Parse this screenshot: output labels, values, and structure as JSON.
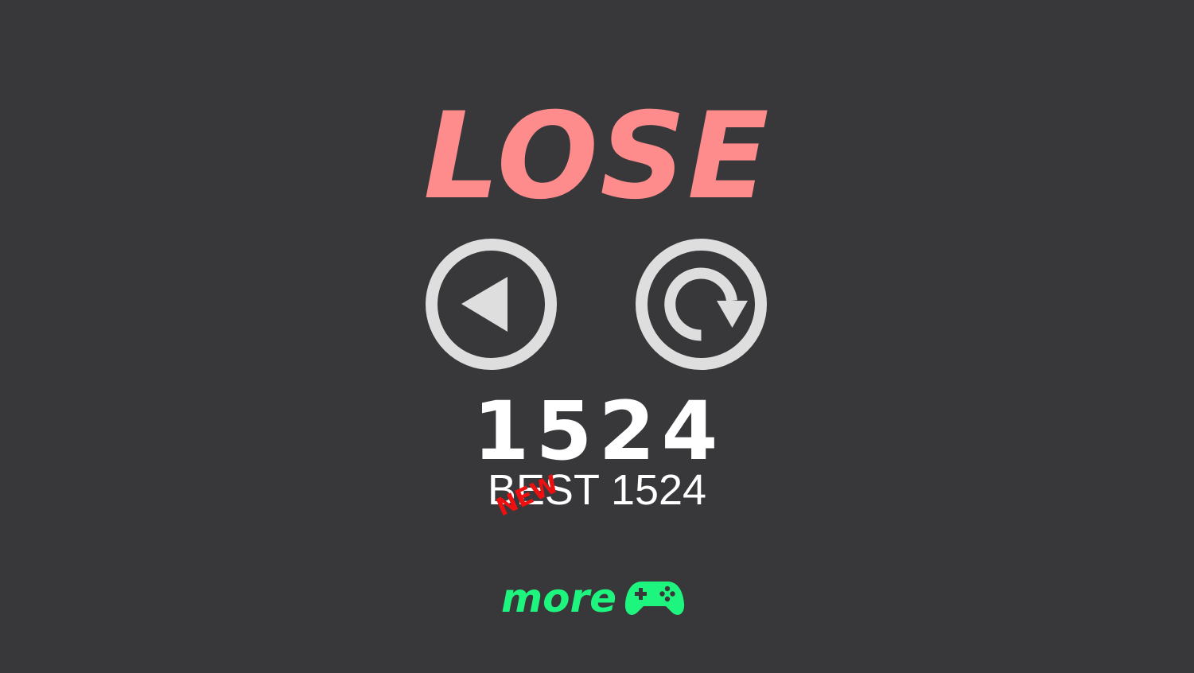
{
  "result": {
    "title": "LOSE"
  },
  "buttons": {
    "back_icon": "back-arrow-icon",
    "restart_icon": "restart-icon"
  },
  "score": {
    "value": "1524",
    "best_label": "BEST 1524",
    "new_badge": "NEW"
  },
  "more_games": {
    "label": "more",
    "icon": "gamepad-icon"
  },
  "colors": {
    "background": "#38383b",
    "title": "#ff8c8c",
    "button": "#dedede",
    "score": "#ffffff",
    "new_badge": "#ee1010",
    "more": "#1ef57e"
  }
}
